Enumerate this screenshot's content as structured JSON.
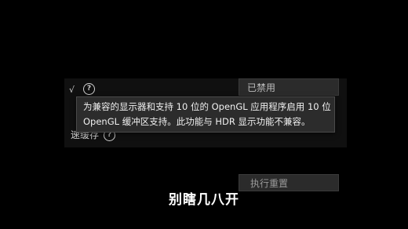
{
  "setting_top": {
    "edge_mark": "√",
    "help_glyph": "?",
    "dropdown_value": "已禁用"
  },
  "setting_bottom": {
    "label": "速缓存",
    "help_glyph": "?",
    "action_label": "执行重置"
  },
  "tooltip": {
    "line1": "为兼容的显示器和支持 10 位的 OpenGL 应用程序启用 10 位",
    "line2": "OpenGL 缓冲区支持。此功能与 HDR 显示功能不兼容。"
  },
  "caption": "别瞎几八开",
  "colors": {
    "background": "#000000",
    "panel": "#101010",
    "tooltip_bg": "#2c2c2c",
    "text": "#f0f0f0"
  }
}
